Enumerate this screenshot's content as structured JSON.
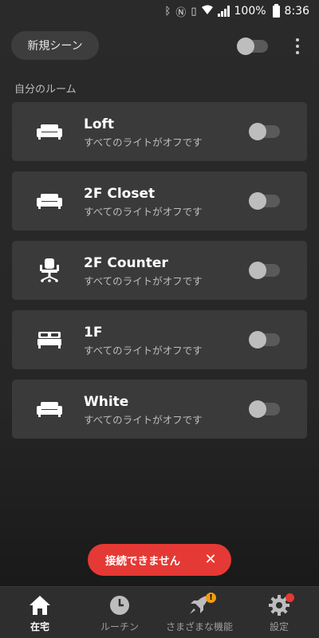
{
  "status_bar": {
    "battery": "100%",
    "time": "8:36"
  },
  "top_bar": {
    "scene_button_label": "新規シーン"
  },
  "section_label": "自分のルーム",
  "rooms": [
    {
      "name": "Loft",
      "status": "すべてのライトがオフです",
      "icon": "sofa-icon"
    },
    {
      "name": "2F Closet",
      "status": "すべてのライトがオフです",
      "icon": "sofa-icon"
    },
    {
      "name": "2F Counter",
      "status": "すべてのライトがオフです",
      "icon": "office-chair-icon"
    },
    {
      "name": "1F",
      "status": "すべてのライトがオフです",
      "icon": "bed-icon"
    },
    {
      "name": "White",
      "status": "すべてのライトがオフです",
      "icon": "sofa-icon"
    }
  ],
  "snackbar": {
    "text": "接続できません",
    "close": "✕"
  },
  "bottom_nav": {
    "items": [
      {
        "label": "在宅",
        "icon": "home-icon"
      },
      {
        "label": "ルーチン",
        "icon": "clock-icon"
      },
      {
        "label": "さまざまな機能",
        "icon": "rocket-icon",
        "badge": "!"
      },
      {
        "label": "設定",
        "icon": "gear-icon"
      }
    ]
  },
  "colors": {
    "accent_red": "#e53935",
    "badge_orange": "#f39c12",
    "card_bg": "#3a3a3a"
  }
}
